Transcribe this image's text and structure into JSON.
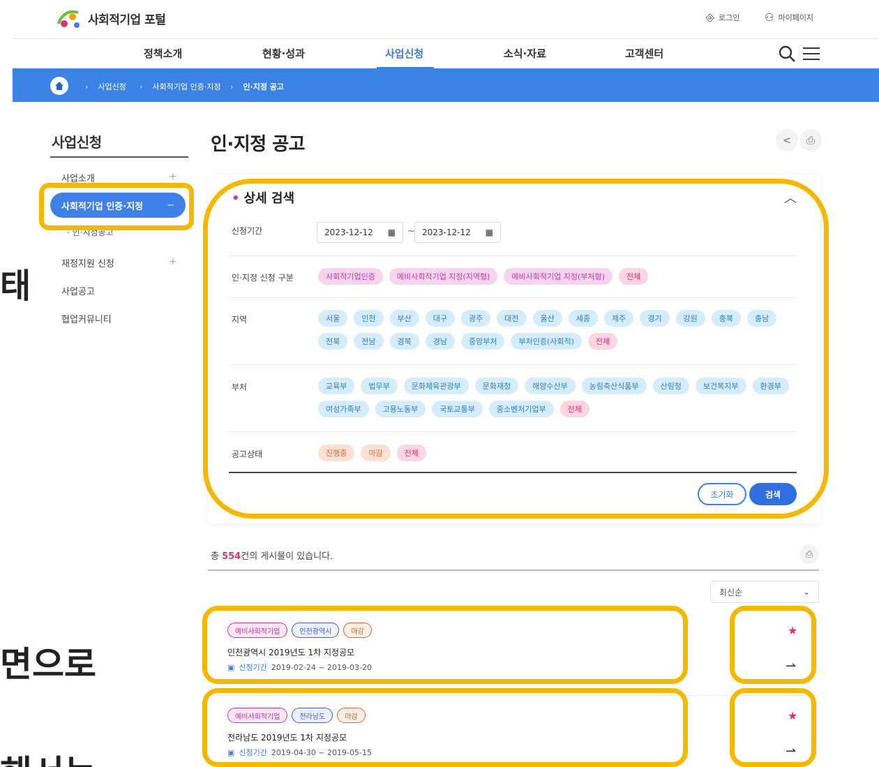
{
  "header": {
    "logo_text": "사회적기업 포털",
    "login": "로그인",
    "mypage": "마이페이지",
    "gnb": [
      "정책소개",
      "현황·성과",
      "사업신청",
      "소식·자료",
      "고객센터"
    ]
  },
  "breadcrumb": [
    "사업신청",
    "사회적기업 인증·지정",
    "인·지정 공고"
  ],
  "lnb": {
    "title": "사업신청",
    "items": [
      {
        "label": "사업소개",
        "toggle": "+"
      },
      {
        "label": "사회적기업 인증·지정",
        "toggle": "−"
      },
      {
        "label": "재정지원 신청",
        "toggle": "+"
      },
      {
        "label": "사업공고",
        "toggle": ""
      },
      {
        "label": "협업커뮤니티",
        "toggle": ""
      }
    ],
    "sub_item": "인·지정공고"
  },
  "side_fragments": [
    "태",
    "면으로",
    "해서는"
  ],
  "main": {
    "title": "인·지정 공고",
    "search": {
      "title": "상세 검색",
      "period_label": "신청기간",
      "date_from": "2023-12-12",
      "date_to": "2023-12-12",
      "date_sep": "~",
      "type_label": "인·지정 신청 구분",
      "types": [
        "사회적기업인증",
        "예비사회적기업 지정(지역형)",
        "예비사회적기업 지정(부처형)",
        "전체"
      ],
      "region_label": "지역",
      "regions": [
        "서울",
        "인천",
        "부산",
        "대구",
        "광주",
        "대전",
        "울산",
        "세종",
        "제주",
        "경기",
        "강원",
        "충북",
        "충남",
        "전북",
        "전남",
        "경북",
        "경남",
        "중앙부처",
        "부처인증(사회적)",
        "전체"
      ],
      "ministry_label": "부처",
      "ministries": [
        "교육부",
        "법무부",
        "문화체육관광부",
        "문화재청",
        "해양수산부",
        "농림축산식품부",
        "산림청",
        "보건복지부",
        "환경부",
        "여성가족부",
        "고용노동부",
        "국토교통부",
        "중소벤처기업부",
        "전체"
      ],
      "status_label": "공고상태",
      "statuses": [
        "진행중",
        "마감",
        "전체"
      ],
      "reset_label": "초기화",
      "search_label": "검색"
    },
    "results": {
      "total_prefix": "총 ",
      "total_count": "554",
      "total_suffix": "건의 게시물이 있습니다.",
      "sort_label": "최신순",
      "items": [
        {
          "tags": [
            "예비사회적기업",
            "인천광역시",
            "마감"
          ],
          "title": "인천광역시 2019년도 1차 지정공모",
          "date_label": "신청기간",
          "date": "2019-02-24 ~ 2019-03-20"
        },
        {
          "tags": [
            "예비사회적기업",
            "전라남도",
            "마감"
          ],
          "title": "전라남도 2019년도 1차 지정공모",
          "date_label": "신청기간",
          "date": "2019-04-30 ~ 2019-05-15"
        }
      ]
    }
  },
  "colors": {
    "accent": "#3f7fe8",
    "band": "#3a82e4",
    "highlight": "#f5b800",
    "pink": "#e0336d"
  }
}
